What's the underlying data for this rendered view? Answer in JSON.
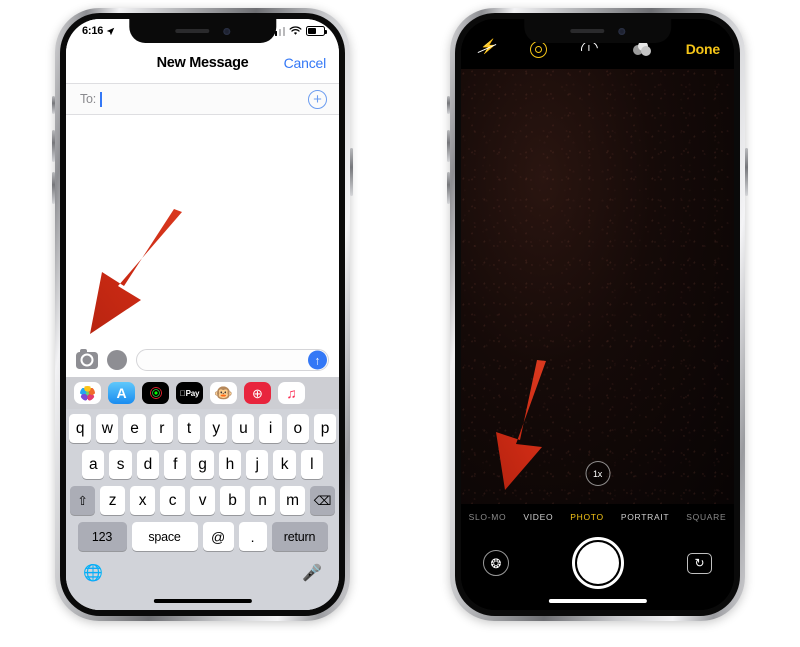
{
  "left_phone": {
    "name": "iphone-messages",
    "status_bar": {
      "time": "6:16",
      "location_icon": "location-arrow-icon",
      "signal_icon": "cellular-signal-icon",
      "wifi_icon": "wifi-icon",
      "battery_icon": "battery-icon"
    },
    "nav": {
      "title": "New Message",
      "cancel_label": "Cancel"
    },
    "to_row": {
      "label": "To:",
      "add_contact_icon": "plus-circle-icon"
    },
    "input_bar": {
      "camera_icon": "camera-icon",
      "app_store_icon": "app-store-icon",
      "field_placeholder": "",
      "field_value": "",
      "send_icon": "send-arrow-up-icon"
    },
    "app_drawer": [
      {
        "name": "photos-app",
        "icon": "photos-icon"
      },
      {
        "name": "app-store-app",
        "icon": "app-store-icon"
      },
      {
        "name": "music-record-app",
        "icon": "vinyl-record-icon"
      },
      {
        "name": "apple-pay-app",
        "icon": "apple-pay-icon",
        "label": "Pay"
      },
      {
        "name": "memoji-app",
        "icon": "memoji-monkey-icon",
        "glyph": "🐵"
      },
      {
        "name": "images-gif-app",
        "icon": "gif-search-icon",
        "glyph": "⊕"
      },
      {
        "name": "music-app",
        "icon": "music-note-icon",
        "glyph": "♫"
      }
    ],
    "keyboard": {
      "row1": [
        "q",
        "w",
        "e",
        "r",
        "t",
        "y",
        "u",
        "i",
        "o",
        "p"
      ],
      "row2": [
        "a",
        "s",
        "d",
        "f",
        "g",
        "h",
        "j",
        "k",
        "l"
      ],
      "row3_shift": "shift-icon",
      "row3": [
        "z",
        "x",
        "c",
        "v",
        "b",
        "n",
        "m"
      ],
      "row3_delete": "delete-backspace-icon",
      "numbers_key": "123",
      "space_key": "space",
      "at_key": "@",
      "dot_key": ".",
      "return_key": "return",
      "globe_icon": "globe-icon",
      "mic_icon": "microphone-icon"
    }
  },
  "right_phone": {
    "name": "iphone-camera",
    "top_bar": {
      "flash_icon": "flash-off-icon",
      "live_photo_icon": "live-photo-icon",
      "timer_icon": "timer-icon",
      "filters_icon": "filters-icon",
      "done_label": "Done"
    },
    "viewfinder": {
      "zoom_label": "1x"
    },
    "modes": [
      {
        "label": "SLO-MO",
        "active": false,
        "dim": true
      },
      {
        "label": "VIDEO",
        "active": false,
        "dim": false
      },
      {
        "label": "PHOTO",
        "active": true,
        "dim": false
      },
      {
        "label": "PORTRAIT",
        "active": false,
        "dim": false
      },
      {
        "label": "SQUARE",
        "active": false,
        "dim": true
      }
    ],
    "bottom": {
      "effects_icon": "effects-star-icon",
      "shutter_icon": "shutter-button",
      "flip_icon": "flip-camera-icon"
    }
  },
  "annotations": {
    "arrow_color": "#cf2a18",
    "left_arrow": {
      "name": "annotation-arrow-to-camera-icon"
    },
    "right_arrow": {
      "name": "annotation-arrow-to-effects-button"
    }
  }
}
